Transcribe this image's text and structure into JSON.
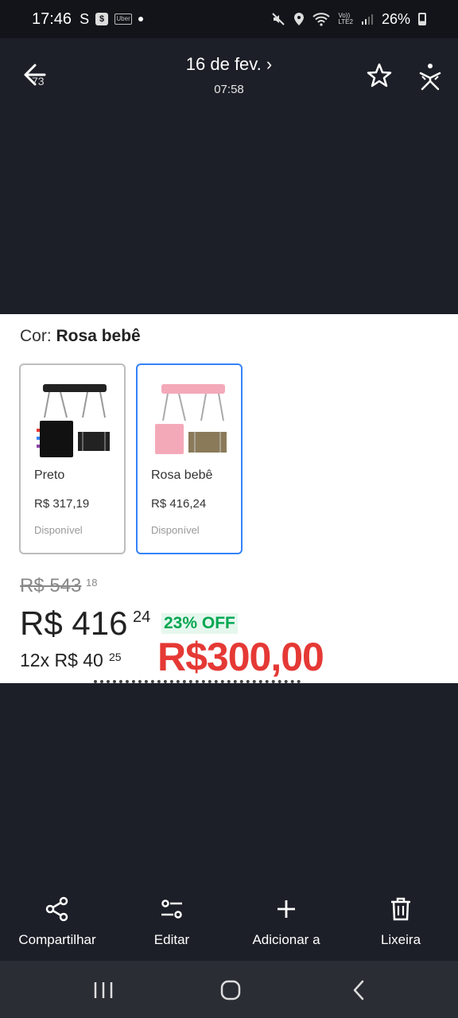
{
  "status_bar": {
    "time": "17:46",
    "battery": "26%",
    "icons": [
      "s-icon",
      "shop-icon",
      "uber-icon",
      "dot-icon",
      "mute-icon",
      "location-icon",
      "wifi-icon",
      "volte-icon",
      "signal-icon",
      "battery-icon"
    ]
  },
  "top_bar": {
    "date": "16 de fev. ›",
    "time": "07:58",
    "back_badge": "73"
  },
  "photo": {
    "color_prefix": "Cor: ",
    "color_value": "Rosa bebê",
    "variants": [
      {
        "name": "Preto",
        "price": "R$ 317,19",
        "status": "Disponível",
        "color": "#222222"
      },
      {
        "name": "Rosa bebê",
        "price": "R$ 416,24",
        "status": "Disponível",
        "color": "#f4a9b8"
      }
    ],
    "old_price": "R$ 543",
    "old_cents": "18",
    "price": "R$ 416",
    "price_cents": "24",
    "discount": "23% OFF",
    "installments": "12x R$ 40",
    "installments_cents": "25",
    "overlay_price": "R$300,00",
    "accent_color": "#3483fa",
    "discount_color": "#00a650",
    "overlay_color": "#e53935"
  },
  "actions": [
    {
      "label": "Compartilhar",
      "icon": "share-icon"
    },
    {
      "label": "Editar",
      "icon": "edit-sliders-icon"
    },
    {
      "label": "Adicionar a",
      "icon": "plus-icon"
    },
    {
      "label": "Lixeira",
      "icon": "trash-icon"
    }
  ],
  "nav": [
    "recents-icon",
    "home-icon",
    "back-icon"
  ]
}
